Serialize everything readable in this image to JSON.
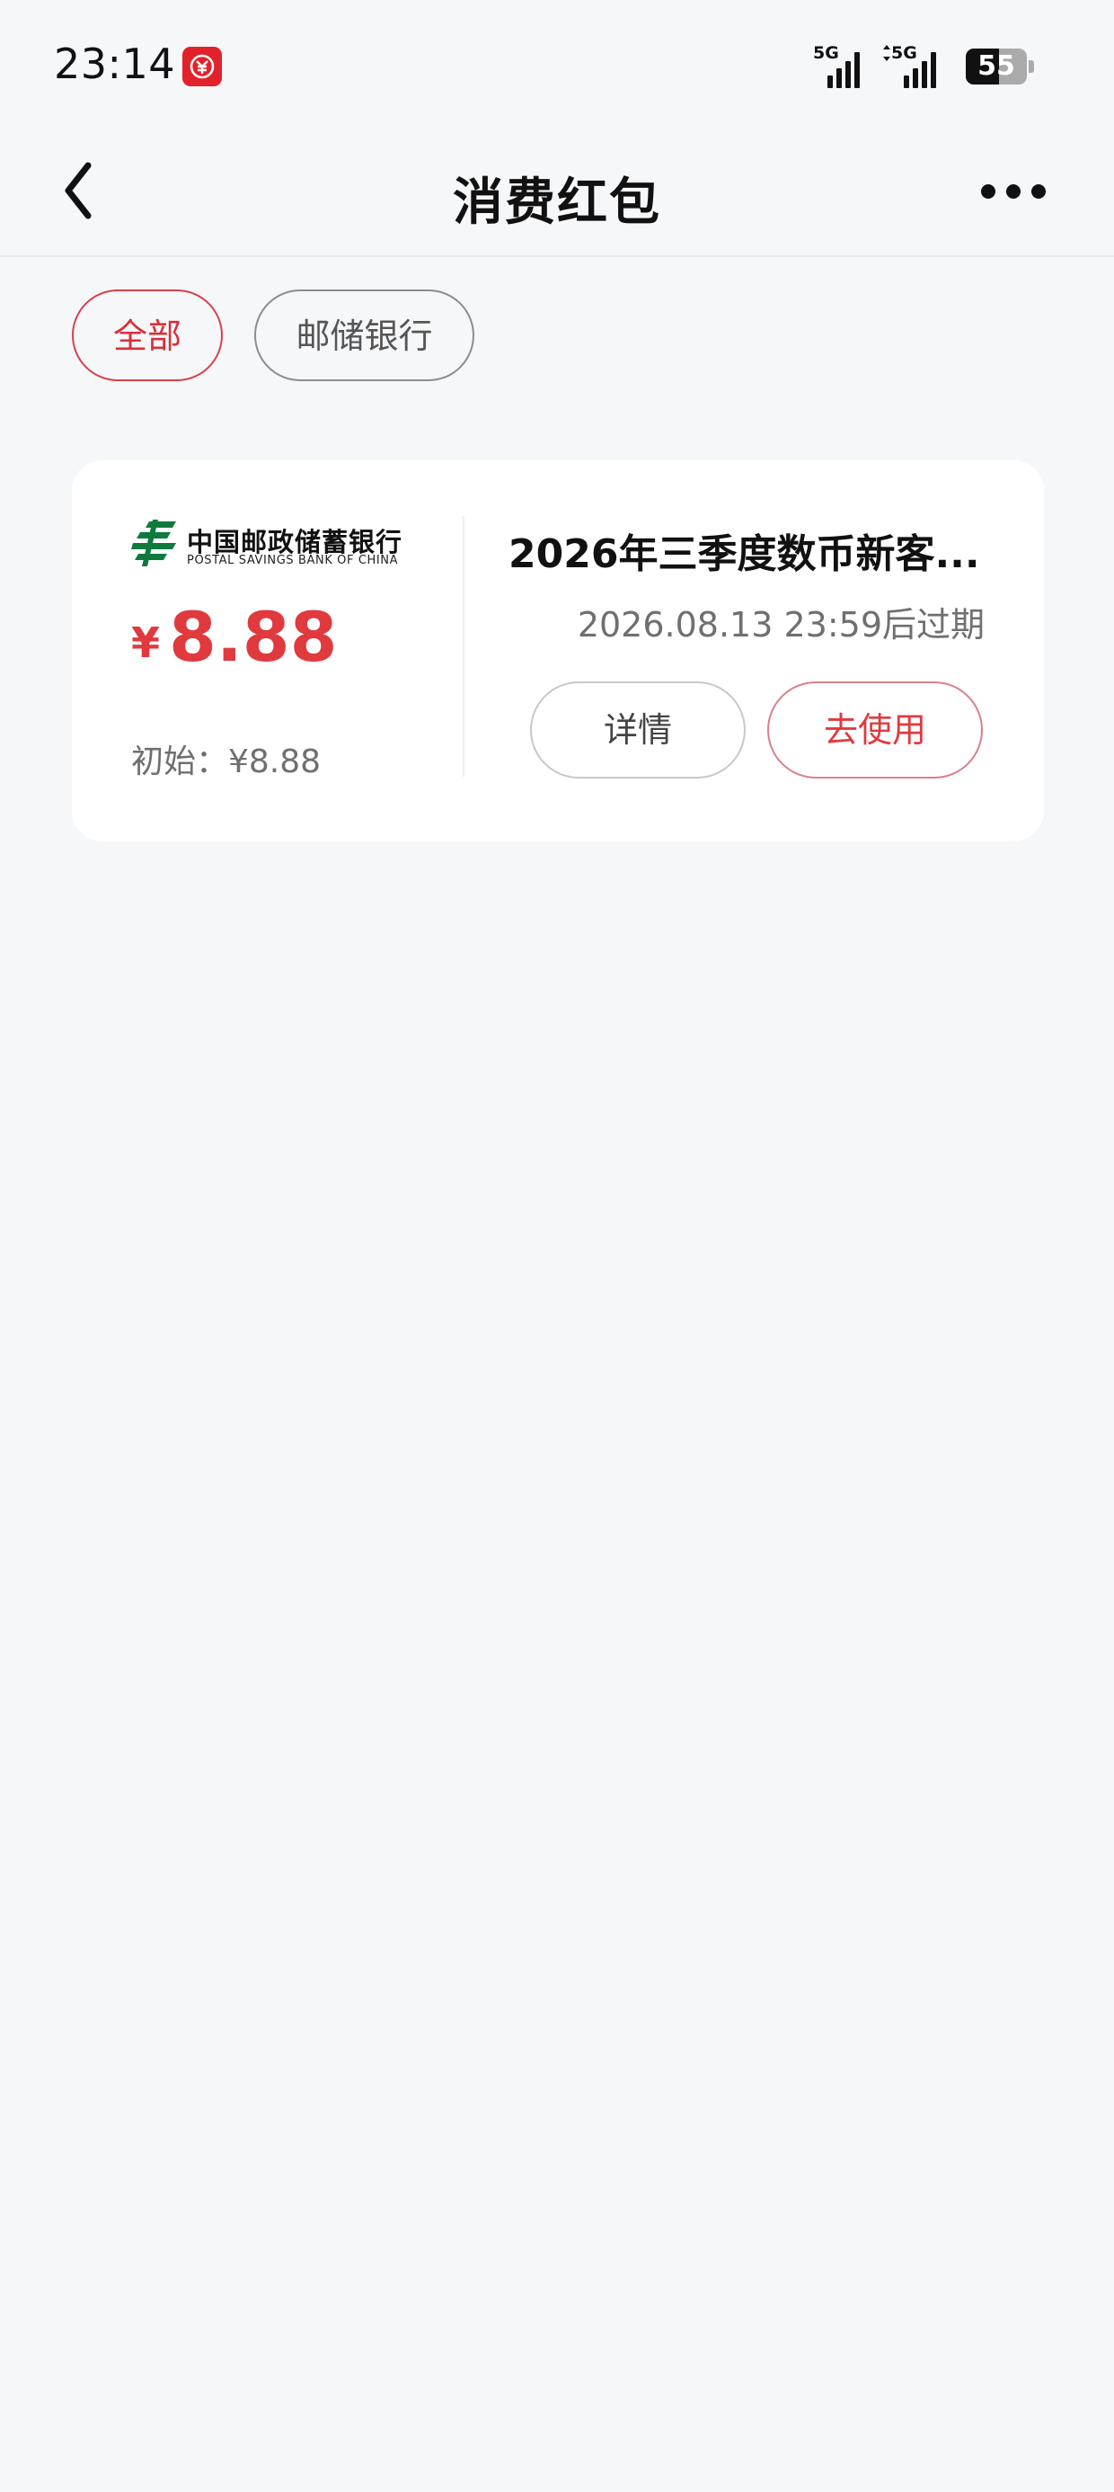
{
  "status_bar": {
    "time": "23:14",
    "app_badge_icon": "digital-rmb-icon",
    "sim1_label": "5G",
    "sim2_label": "5G",
    "battery_level": "55",
    "battery_fraction": 0.55
  },
  "nav": {
    "title": "消费红包",
    "back_icon": "chevron-left-icon",
    "more_icon": "more-dots-icon"
  },
  "filters": [
    {
      "label": "全部",
      "selected": true
    },
    {
      "label": "邮储银行",
      "selected": false
    }
  ],
  "coupon": {
    "bank_name_cn": "中国邮政储蓄银行",
    "bank_name_en": "POSTAL SAVINGS BANK OF CHINA",
    "currency_symbol": "¥",
    "amount": "8.88",
    "initial_text": "初始：¥8.88",
    "title": "2026年三季度数币新客...",
    "expiry": "2026.08.13 23:59后过期",
    "detail_label": "详情",
    "use_label": "去使用"
  },
  "colors": {
    "accent_red": "#e03a3e",
    "background": "#f6f7f9",
    "card": "#ffffff",
    "psbc_green": "#0e7a3d"
  }
}
